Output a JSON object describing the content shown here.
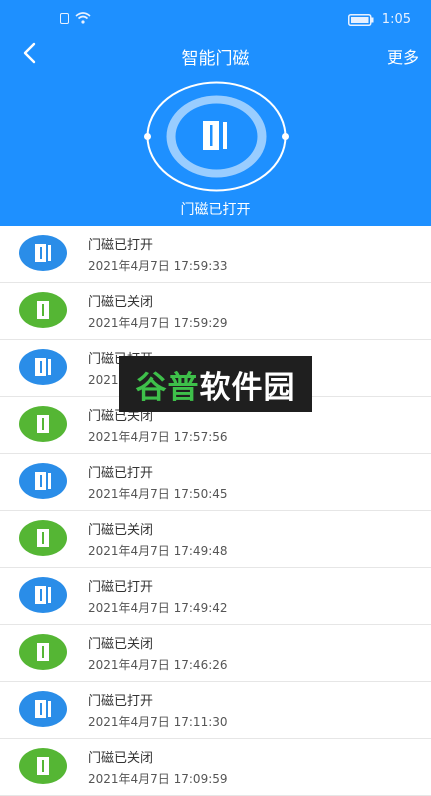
{
  "status_bar": {
    "time": "1:05"
  },
  "nav": {
    "title": "智能门磁",
    "more_label": "更多"
  },
  "sensor": {
    "status_label": "门磁已打开"
  },
  "history": [
    {
      "status": "门磁已打开",
      "time": "2021年4月7日 17:59:33",
      "state": "open"
    },
    {
      "status": "门磁已关闭",
      "time": "2021年4月7日 17:59:29",
      "state": "closed"
    },
    {
      "status": "门磁已打开",
      "time": "2021年4月7日 17:58:??",
      "state": "open"
    },
    {
      "status": "门磁已关闭",
      "time": "2021年4月7日 17:57:56",
      "state": "closed"
    },
    {
      "status": "门磁已打开",
      "time": "2021年4月7日 17:50:45",
      "state": "open"
    },
    {
      "status": "门磁已关闭",
      "time": "2021年4月7日 17:49:48",
      "state": "closed"
    },
    {
      "status": "门磁已打开",
      "time": "2021年4月7日 17:49:42",
      "state": "open"
    },
    {
      "status": "门磁已关闭",
      "time": "2021年4月7日 17:46:26",
      "state": "closed"
    },
    {
      "status": "门磁已打开",
      "time": "2021年4月7日 17:11:30",
      "state": "open"
    },
    {
      "status": "门磁已关闭",
      "time": "2021年4月7日 17:09:59",
      "state": "closed"
    }
  ],
  "watermark": {
    "part1": "谷普",
    "part2": "软件园"
  },
  "colors": {
    "header": "#1e90ff",
    "open": "#2a8de8",
    "closed": "#55b634"
  }
}
